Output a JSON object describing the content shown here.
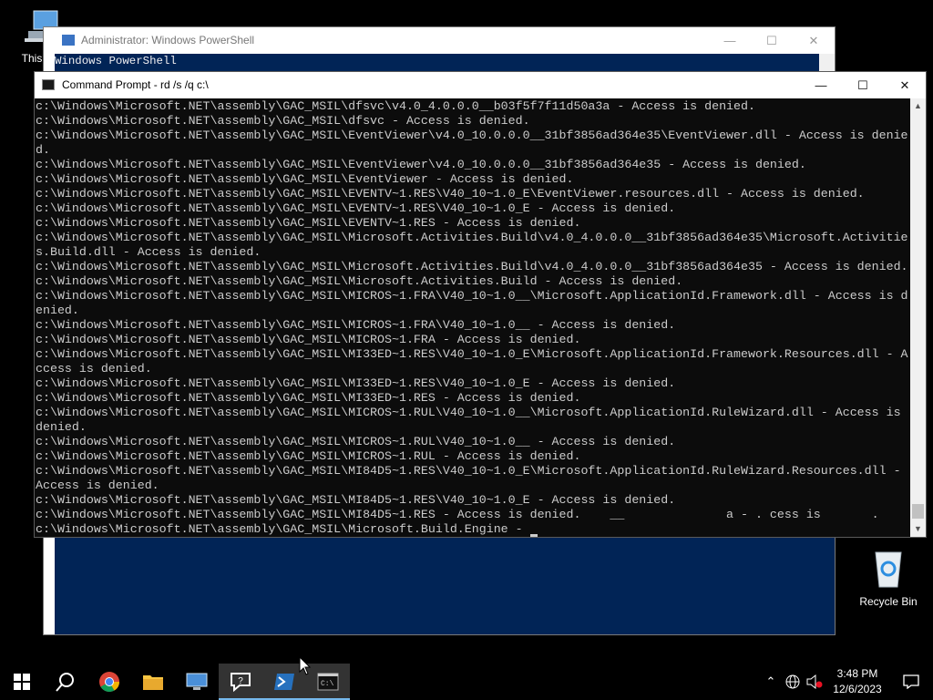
{
  "desktop": {
    "this_pc_label": "This PC",
    "recycle_bin_label": "Recycle Bin"
  },
  "powershell": {
    "title": "Administrator: Windows PowerShell",
    "line1": "Windows PowerShell",
    "background": "#012456"
  },
  "cmd": {
    "title": "Command Prompt - rd  /s /q c:\\",
    "lines": [
      "c:\\Windows\\Microsoft.NET\\assembly\\GAC_MSIL\\dfsvc\\v4.0_4.0.0.0__b03f5f7f11d50a3a - Access is denied.",
      "c:\\Windows\\Microsoft.NET\\assembly\\GAC_MSIL\\dfsvc - Access is denied.",
      "c:\\Windows\\Microsoft.NET\\assembly\\GAC_MSIL\\EventViewer\\v4.0_10.0.0.0__31bf3856ad364e35\\EventViewer.dll - Access is denie",
      "d.",
      "c:\\Windows\\Microsoft.NET\\assembly\\GAC_MSIL\\EventViewer\\v4.0_10.0.0.0__31bf3856ad364e35 - Access is denied.",
      "c:\\Windows\\Microsoft.NET\\assembly\\GAC_MSIL\\EventViewer - Access is denied.",
      "c:\\Windows\\Microsoft.NET\\assembly\\GAC_MSIL\\EVENTV~1.RES\\V40_10~1.0_E\\EventViewer.resources.dll - Access is denied.",
      "c:\\Windows\\Microsoft.NET\\assembly\\GAC_MSIL\\EVENTV~1.RES\\V40_10~1.0_E - Access is denied.",
      "c:\\Windows\\Microsoft.NET\\assembly\\GAC_MSIL\\EVENTV~1.RES - Access is denied.",
      "c:\\Windows\\Microsoft.NET\\assembly\\GAC_MSIL\\Microsoft.Activities.Build\\v4.0_4.0.0.0__31bf3856ad364e35\\Microsoft.Activitie",
      "s.Build.dll - Access is denied.",
      "c:\\Windows\\Microsoft.NET\\assembly\\GAC_MSIL\\Microsoft.Activities.Build\\v4.0_4.0.0.0__31bf3856ad364e35 - Access is denied.",
      "c:\\Windows\\Microsoft.NET\\assembly\\GAC_MSIL\\Microsoft.Activities.Build - Access is denied.",
      "c:\\Windows\\Microsoft.NET\\assembly\\GAC_MSIL\\MICROS~1.FRA\\V40_10~1.0__\\Microsoft.ApplicationId.Framework.dll - Access is d",
      "enied.",
      "c:\\Windows\\Microsoft.NET\\assembly\\GAC_MSIL\\MICROS~1.FRA\\V40_10~1.0__ - Access is denied.",
      "c:\\Windows\\Microsoft.NET\\assembly\\GAC_MSIL\\MICROS~1.FRA - Access is denied.",
      "c:\\Windows\\Microsoft.NET\\assembly\\GAC_MSIL\\MI33ED~1.RES\\V40_10~1.0_E\\Microsoft.ApplicationId.Framework.Resources.dll - A",
      "ccess is denied.",
      "c:\\Windows\\Microsoft.NET\\assembly\\GAC_MSIL\\MI33ED~1.RES\\V40_10~1.0_E - Access is denied.",
      "c:\\Windows\\Microsoft.NET\\assembly\\GAC_MSIL\\MI33ED~1.RES - Access is denied.",
      "c:\\Windows\\Microsoft.NET\\assembly\\GAC_MSIL\\MICROS~1.RUL\\V40_10~1.0__\\Microsoft.ApplicationId.RuleWizard.dll - Access is",
      "denied.",
      "c:\\Windows\\Microsoft.NET\\assembly\\GAC_MSIL\\MICROS~1.RUL\\V40_10~1.0__ - Access is denied.",
      "c:\\Windows\\Microsoft.NET\\assembly\\GAC_MSIL\\MICROS~1.RUL - Access is denied.",
      "c:\\Windows\\Microsoft.NET\\assembly\\GAC_MSIL\\MI84D5~1.RES\\V40_10~1.0_E\\Microsoft.ApplicationId.RuleWizard.Resources.dll -",
      "Access is denied.",
      "c:\\Windows\\Microsoft.NET\\assembly\\GAC_MSIL\\MI84D5~1.RES\\V40_10~1.0_E - Access is denied.",
      "c:\\Windows\\Microsoft.NET\\assembly\\GAC_MSIL\\MI84D5~1.RES - Access is denied.    __              a - . cess is       .",
      "c:\\Windows\\Microsoft.NET\\assembly\\GAC_MSIL\\Microsoft.Build.Engine - "
    ]
  },
  "taskbar": {
    "apps": [
      {
        "name": "start-button",
        "icon": "windows-logo"
      },
      {
        "name": "search-button",
        "icon": "search-icon"
      },
      {
        "name": "chrome",
        "icon": "chrome-icon"
      },
      {
        "name": "file-explorer",
        "icon": "folder-icon"
      },
      {
        "name": "remote-desktop",
        "icon": "computer-icon"
      },
      {
        "name": "quick-assist",
        "icon": "quick-assist-icon"
      },
      {
        "name": "powershell",
        "icon": "powershell-icon"
      },
      {
        "name": "command-prompt",
        "icon": "cmd-icon"
      }
    ],
    "time": "3:48 PM",
    "date": "12/6/2023"
  }
}
